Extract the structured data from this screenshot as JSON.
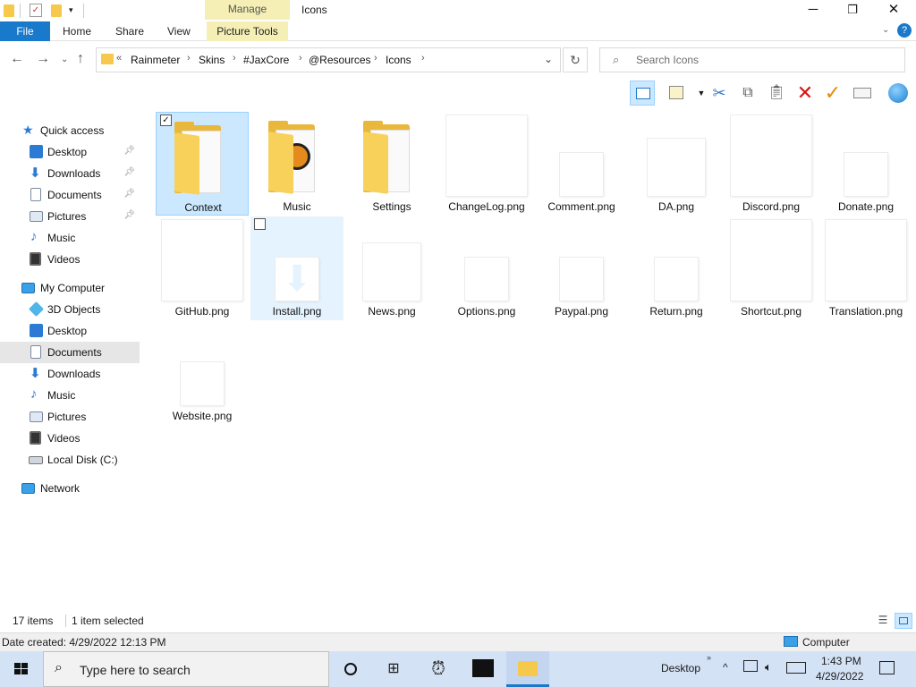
{
  "window": {
    "title": "Icons",
    "manage_tab": "Manage",
    "minimize": "─",
    "maximize": "❐",
    "close": "✕"
  },
  "ribbon": {
    "file": "File",
    "tabs": [
      "Home",
      "Share",
      "View"
    ],
    "picture_tools": "Picture Tools",
    "help": "?"
  },
  "address": {
    "prefix": "«",
    "crumbs": [
      "Rainmeter",
      "Skins",
      "#JaxCore",
      "@Resources",
      "Icons"
    ],
    "search_placeholder": "Search Icons"
  },
  "nav": {
    "quick_access": "Quick access",
    "quick_items": [
      "Desktop",
      "Downloads",
      "Documents",
      "Pictures",
      "Music",
      "Videos"
    ],
    "my_computer": "My Computer",
    "computer_items": [
      "3D Objects",
      "Desktop",
      "Documents",
      "Downloads",
      "Music",
      "Pictures",
      "Videos",
      "Local Disk (C:)"
    ],
    "network": "Network"
  },
  "files": [
    {
      "name": "Context",
      "kind": "folder"
    },
    {
      "name": "Music",
      "kind": "folder"
    },
    {
      "name": "Settings",
      "kind": "folder"
    },
    {
      "name": "ChangeLog.png",
      "kind": "image"
    },
    {
      "name": "Comment.png",
      "kind": "image"
    },
    {
      "name": "DA.png",
      "kind": "image"
    },
    {
      "name": "Discord.png",
      "kind": "image"
    },
    {
      "name": "Donate.png",
      "kind": "image"
    },
    {
      "name": "GitHub.png",
      "kind": "image"
    },
    {
      "name": "Install.png",
      "kind": "image"
    },
    {
      "name": "News.png",
      "kind": "image"
    },
    {
      "name": "Options.png",
      "kind": "image"
    },
    {
      "name": "Paypal.png",
      "kind": "image"
    },
    {
      "name": "Return.png",
      "kind": "image"
    },
    {
      "name": "Shortcut.png",
      "kind": "image"
    },
    {
      "name": "Translation.png",
      "kind": "image"
    },
    {
      "name": "Website.png",
      "kind": "image"
    }
  ],
  "status": {
    "item_count": "17 items",
    "selection": "1 item selected",
    "date_created": "Date created: 4/29/2022 12:13 PM",
    "computer": "Computer"
  },
  "taskbar": {
    "search_placeholder": "Type here to search",
    "desktop_label": "Desktop",
    "time": "1:43 PM",
    "date": "4/29/2022"
  },
  "colors": {
    "accent": "#1979ca",
    "selection": "#cce8ff",
    "folder": "#f6c84b",
    "manage_tab": "#f5efb5"
  }
}
